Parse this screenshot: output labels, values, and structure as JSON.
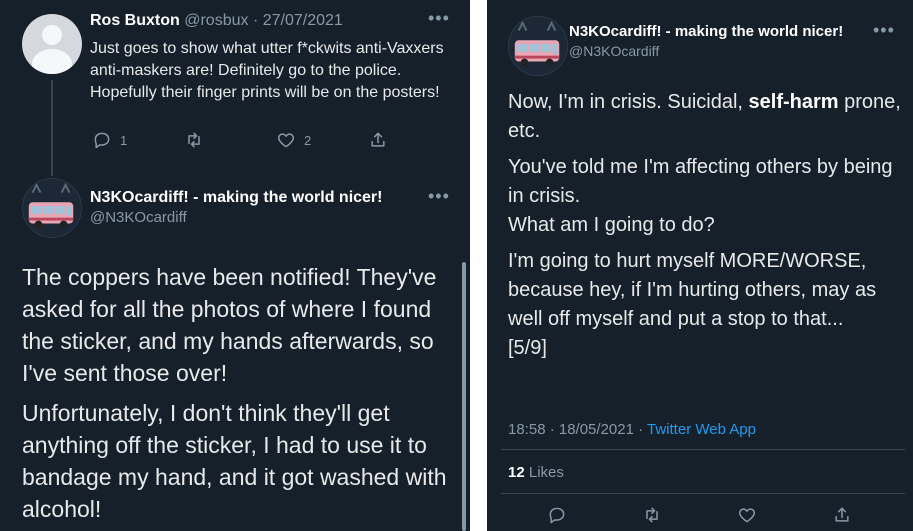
{
  "reply_tweet": {
    "author_name": "Ros Buxton",
    "author_handle": "@rosbux",
    "date": "27/07/2021",
    "text": "Just goes to show what utter f*ckwits anti-Vaxxers anti-maskers are! Definitely go to the police. Hopefully their finger prints will be on the posters!",
    "reply_count": "1",
    "like_count": "2",
    "more_label": "•••"
  },
  "main_tweet_left": {
    "author_name": "N3KOcardiff! - making the world nicer!",
    "author_handle": "@N3KOcardiff",
    "more_label": "•••",
    "paragraph_1": "The coppers have been notified! They've asked for all the photos of where I found the sticker, and my hands afterwards, so I've sent those over!",
    "paragraph_2": "Unfortunately, I don't think they'll get anything off the sticker, I had to use it to bandage my hand, and it got washed with alcohol!"
  },
  "main_tweet_right": {
    "author_name": "N3KOcardiff! - making the world nicer!",
    "author_handle": "@N3KOcardiff",
    "more_label": "•••",
    "p1_before": "Now, I'm in crisis. Suicidal, ",
    "p1_bold": "self-harm",
    "p1_after": " prone, etc.",
    "p2_line1": "You've told me I'm affecting others by being in crisis.",
    "p2_line2": "What am I going to do?",
    "p3": "I'm going to hurt myself MORE/WORSE, because hey, if I'm hurting others, may as well off myself and put a stop to that...",
    "p3_tag": "[5/9]",
    "time": "18:58 · 18/05/2021",
    "separator": " · ",
    "source": "Twitter Web App",
    "likes_count": "12",
    "likes_label": " Likes"
  },
  "icons": [
    "reply-icon",
    "retweet-icon",
    "like-icon",
    "share-icon"
  ],
  "colors": {
    "background": "#15202b",
    "text": "#e7e9ea",
    "muted": "#8899a6",
    "link": "#1d9bf0",
    "divider": "#38444d"
  }
}
